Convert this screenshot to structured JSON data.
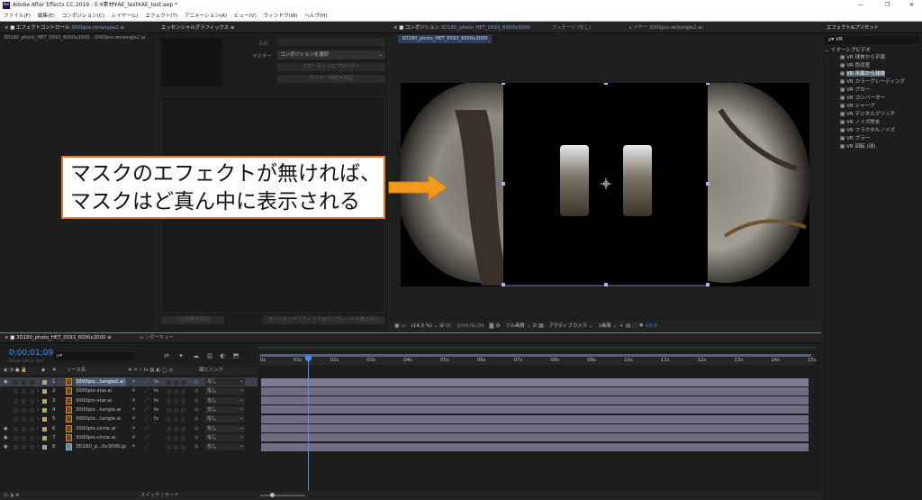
{
  "app": {
    "title": "Adobe After Effects CC 2019 - E:¥素材¥AE_test¥AE_test.aep *",
    "logo": "Ae",
    "controls": [
      "—",
      "❐",
      "✕"
    ]
  },
  "menu": [
    "ファイル(F)",
    "編集(E)",
    "コンポジション(C)",
    "レイヤー(L)",
    "エフェクト(T)",
    "アニメーション(A)",
    "ビュー(V)",
    "ウィンドウ(W)",
    "ヘルプ(H)"
  ],
  "effect_controls": {
    "tab_prefix": "エフェクトコントロール",
    "tab_layer": "3000pix-rectangle2.ai",
    "breadcrumb": "3D180_photo_HET_0593_6000x3000 · 3000pix-rectangle2.ai"
  },
  "essential_graphics": {
    "tab": "エッセンシャルグラフィックス",
    "name_label": "名前",
    "master_label": "マスター",
    "master_value": "コンポジションを選択",
    "btn_add_property": "スポーティングプロパティ",
    "btn_export": "ポスター時間を設定",
    "btn_solo": "ソロ状態を有効",
    "btn_bottom": "モーショングラフィックステンプレートを書き出し"
  },
  "composition": {
    "tab_prefix": "コンポジション",
    "tab_comp": "3D180_photo_HET_0593_6000x3000",
    "footage_tab": "フッテージ (なし)",
    "layer_tab": "レイヤー 3000pix-rectangle2.ai",
    "subtab": "3D180_photo_HET_0593_6000x3000",
    "footer": {
      "zoom": "(14.3 %)",
      "time": "0;00;01;09",
      "resolution": "フル画質",
      "camera": "アクティブカメラ",
      "views": "1画面",
      "exposure": "+0.0"
    }
  },
  "annotation": {
    "line1": "マスクのエフェクトが無ければ、",
    "line2": "マスクはど真ん中に表示される"
  },
  "effects_presets": {
    "tab": "エフェクト&プリセット",
    "search": "VR",
    "category": "イマーシブビデオ",
    "items": [
      "VR 球体から平面",
      "VR 色収差",
      "VR 平面から球体",
      "VR カラーグレーディング",
      "VR グロー",
      "VR コンバーター",
      "VR シャープ",
      "VR デジタルグリッチ",
      "VR ノイズ除去",
      "VR フラクタルノイズ",
      "VR ブラー",
      "VR 回転 (球)"
    ],
    "selected_index": 2
  },
  "timeline": {
    "tab": "3D180_photo_HET_0593_6000x3000",
    "render_tab": "レンダーキュー",
    "timecode": "0;00;01;09",
    "timecode_sub": "00039 (29.97 fps)",
    "search_placeholder": "ρ▾",
    "col_num": "#",
    "col_source": "ソース名",
    "col_parent": "親とリンク",
    "ruler": [
      "0s",
      "01s",
      "02s",
      "03s",
      "04s",
      "05s",
      "06s",
      "07s",
      "08s",
      "09s",
      "10s",
      "11s",
      "12s",
      "13s",
      "14s",
      "15s"
    ],
    "playhead_seconds": 1.3,
    "duration_seconds": 15,
    "layers": [
      {
        "num": "1",
        "name": "3000pix...tangle2.ai",
        "parent": "なし",
        "selected": true,
        "vis": true
      },
      {
        "num": "2",
        "name": "3000pix-star.ai",
        "parent": "なし",
        "selected": false,
        "vis": false
      },
      {
        "num": "3",
        "name": "3000pix-star.ai",
        "parent": "なし",
        "selected": false,
        "vis": false
      },
      {
        "num": "4",
        "name": "3000pix...tangle.ai",
        "parent": "なし",
        "selected": false,
        "vis": false
      },
      {
        "num": "5",
        "name": "3000pix...tangle.ai",
        "parent": "なし",
        "selected": false,
        "vis": false
      },
      {
        "num": "6",
        "name": "3000pix-circle.ai",
        "parent": "なし",
        "selected": false,
        "vis": true
      },
      {
        "num": "7",
        "name": "3000pix-circle.ai",
        "parent": "なし",
        "selected": false,
        "vis": true
      },
      {
        "num": "8",
        "name": "3D180_p...0x3000.jpg",
        "parent": "なし",
        "selected": false,
        "vis": true
      }
    ],
    "bottom_label": "スイッチ / モード"
  },
  "colors": {
    "accent": "#2d8ceb",
    "arrow": "#f29a1b",
    "annotation_border": "#e0772b"
  }
}
